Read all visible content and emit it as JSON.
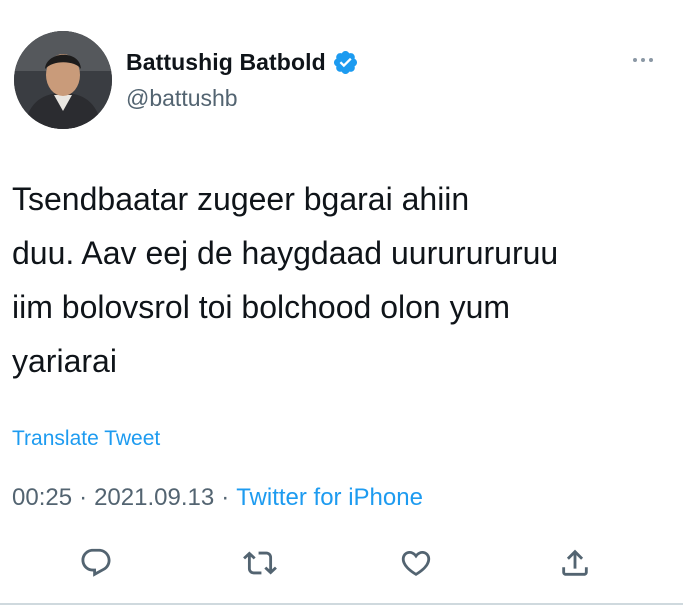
{
  "author": {
    "name": "Battushig Batbold",
    "handle": "@battushb",
    "verified": true
  },
  "tweet": {
    "text": "Tsendbaatar zugeer bgarai ahiin\nduu. Aav eej de haygdaad uururururuu\niim bolovsrol toi bolchood olon yum\nyariarai",
    "translate_label": "Translate Tweet",
    "time": "00:25",
    "date": "2021.09.13",
    "separator": "·",
    "source": "Twitter for iPhone"
  },
  "actions": {
    "icons": [
      "reply-icon",
      "retweet-icon",
      "like-icon",
      "share-icon"
    ]
  },
  "colors": {
    "accent": "#1d9bf0",
    "text": "#0f1419",
    "secondary": "#536471",
    "icon": "#536471"
  }
}
